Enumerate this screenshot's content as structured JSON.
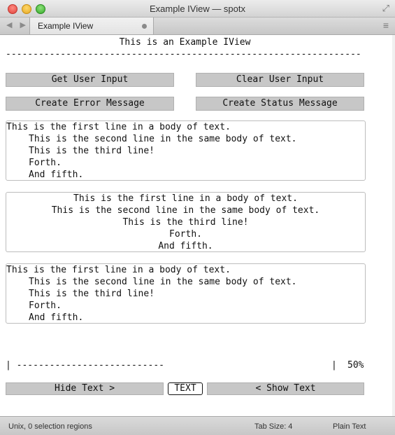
{
  "window": {
    "title": "Example IView — spotx",
    "fullscreen_icon": "fullscreen-arrows-icon"
  },
  "tabbar": {
    "nav_icons": "◀ ▶",
    "tab_label": "Example IView",
    "menu_icon": "≡"
  },
  "content": {
    "header": "This is an Example IView",
    "rule": "-----------------------------------------------------------------",
    "buttons": {
      "get_user_input": "Get User Input",
      "clear_user_input": "Clear User Input",
      "create_error_message": "Create Error Message",
      "create_status_message": "Create Status Message",
      "hide_text": "Hide Text >",
      "text": "TEXT",
      "show_text": "< Show Text"
    },
    "body_lines": [
      "This is the first line in a body of text.",
      "This is the second line in the same body of text.",
      "This is the third line!",
      "Forth.",
      "And fifth."
    ],
    "progress": {
      "bar_left": "| ---------------------------",
      "bar_right": "|",
      "percent": "50%",
      "value": 0.5
    }
  },
  "statusbar": {
    "left": "Unix, 0 selection regions",
    "tab_size": "Tab Size: 4",
    "syntax": "Plain Text"
  }
}
